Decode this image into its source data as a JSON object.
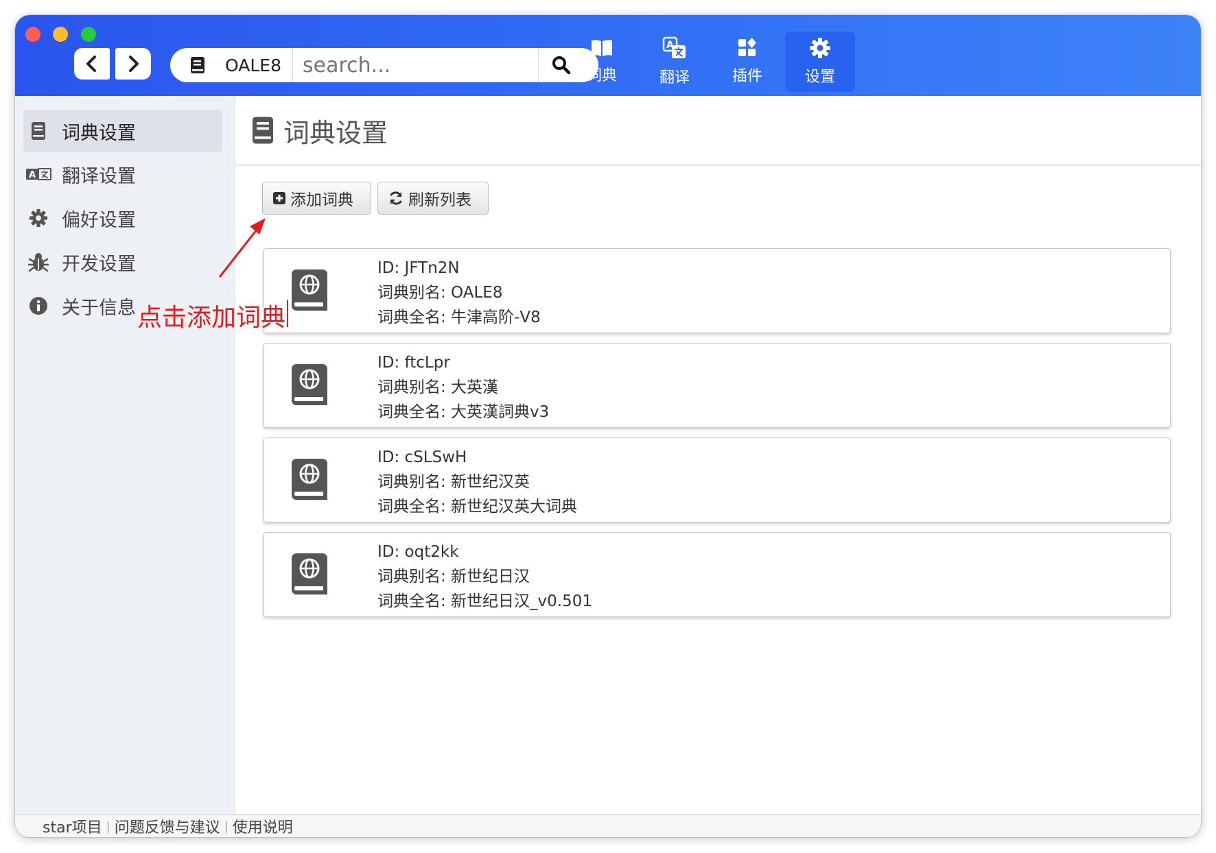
{
  "window": {
    "accent": "#2f66f3"
  },
  "search": {
    "dict_name": "OALE8",
    "placeholder": "search..."
  },
  "top_tabs": [
    {
      "label": "词典",
      "icon": "book-open-icon"
    },
    {
      "label": "翻译",
      "icon": "translate-icon"
    },
    {
      "label": "插件",
      "icon": "plugins-icon"
    },
    {
      "label": "设置",
      "icon": "gear-icon"
    }
  ],
  "sidebar": {
    "items": [
      {
        "label": "词典设置",
        "icon": "book-icon"
      },
      {
        "label": "翻译设置",
        "icon": "translate-icon"
      },
      {
        "label": "偏好设置",
        "icon": "gear-icon"
      },
      {
        "label": "开发设置",
        "icon": "bug-icon"
      },
      {
        "label": "关于信息",
        "icon": "info-icon"
      }
    ]
  },
  "page": {
    "title": "词典设置"
  },
  "toolbar": {
    "add_label": "添加词典",
    "refresh_label": "刷新列表"
  },
  "dictionaries": [
    {
      "id_line": "ID: JFTn2N",
      "alias_line": "词典别名: OALE8",
      "name_line": "词典全名: 牛津高阶-V8"
    },
    {
      "id_line": "ID: ftcLpr",
      "alias_line": "词典别名: 大英漢",
      "name_line": "词典全名: 大英漢詞典v3"
    },
    {
      "id_line": "ID: cSLSwH",
      "alias_line": "词典别名: 新世纪汉英",
      "name_line": "词典全名: 新世纪汉英大词典"
    },
    {
      "id_line": "ID: oqt2kk",
      "alias_line": "词典别名: 新世纪日汉",
      "name_line": "词典全名: 新世纪日汉_v0.501"
    }
  ],
  "footer": {
    "links": [
      "star项目",
      "问题反馈与建议",
      "使用说明"
    ]
  },
  "annotation": {
    "text": "点击添加词典",
    "color": "#e8191a"
  }
}
